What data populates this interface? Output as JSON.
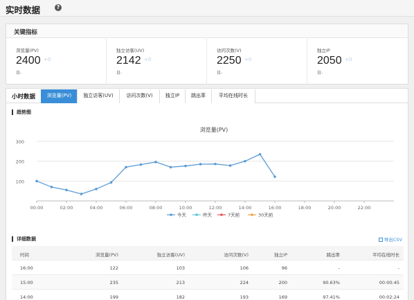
{
  "header": {
    "title": "实时数据"
  },
  "kpi_panel": {
    "title": "关键指标",
    "cards": [
      {
        "label": "浏览量(PV)",
        "value": "2400",
        "delta": "+0",
        "sub": "日-"
      },
      {
        "label": "独立访客(UV)",
        "value": "2142",
        "delta": "+0",
        "sub": "日-"
      },
      {
        "label": "访问次数(V)",
        "value": "2250",
        "delta": "+0",
        "sub": "日-"
      },
      {
        "label": "独立IP",
        "value": "2050",
        "delta": "+0",
        "sub": "日-"
      }
    ]
  },
  "hourly": {
    "title": "小时数据",
    "tabs": [
      "浏览量(PV)",
      "独立访客(UV)",
      "访问次数(V)",
      "独立IP",
      "跳出率",
      "平均在线时长"
    ],
    "active_tab": 0,
    "trend_title": "趋势图",
    "detail_title": "详细数据",
    "export_label": "导出CSV"
  },
  "chart_data": {
    "type": "line",
    "title": "浏览量(PV)",
    "x": [
      "00:00",
      "01:00",
      "02:00",
      "03:00",
      "04:00",
      "05:00",
      "06:00",
      "07:00",
      "08:00",
      "09:00",
      "10:00",
      "11:00",
      "12:00",
      "13:00",
      "14:00",
      "15:00",
      "16:00"
    ],
    "xticks": [
      "00:00",
      "02:00",
      "04:00",
      "06:00",
      "08:00",
      "10:00",
      "12:00",
      "14:00",
      "16:00",
      "18:00",
      "20:00",
      "22:00"
    ],
    "yticks": [
      "100",
      "200",
      "300"
    ],
    "ylim": [
      0,
      300
    ],
    "series": [
      {
        "name": "今天",
        "color": "#5b9bd5",
        "values": [
          100,
          70,
          55,
          35,
          60,
          93,
          170,
          183,
          196,
          170,
          176,
          185,
          186,
          178,
          200,
          235,
          122
        ]
      }
    ],
    "legend": [
      {
        "name": "今天",
        "color": "#5b9bd5"
      },
      {
        "name": "昨天",
        "color": "#59c4d6"
      },
      {
        "name": "7天前",
        "color": "#e65353"
      },
      {
        "name": "30天前",
        "color": "#f0a040"
      }
    ],
    "legend_position": "bottom",
    "grid": true
  },
  "table": {
    "headers": [
      "时间",
      "浏览量(PV)",
      "独立访客(UV)",
      "访问次数(V)",
      "独立IP",
      "跳出率",
      "平均在线时长"
    ],
    "rows": [
      [
        "16:00",
        "122",
        "103",
        "106",
        "96",
        "-",
        "-"
      ],
      [
        "15:00",
        "235",
        "213",
        "224",
        "200",
        "90.63%",
        "00:00:45"
      ],
      [
        "14:00",
        "199",
        "182",
        "193",
        "169",
        "97.41%",
        "00:02:24"
      ]
    ]
  }
}
